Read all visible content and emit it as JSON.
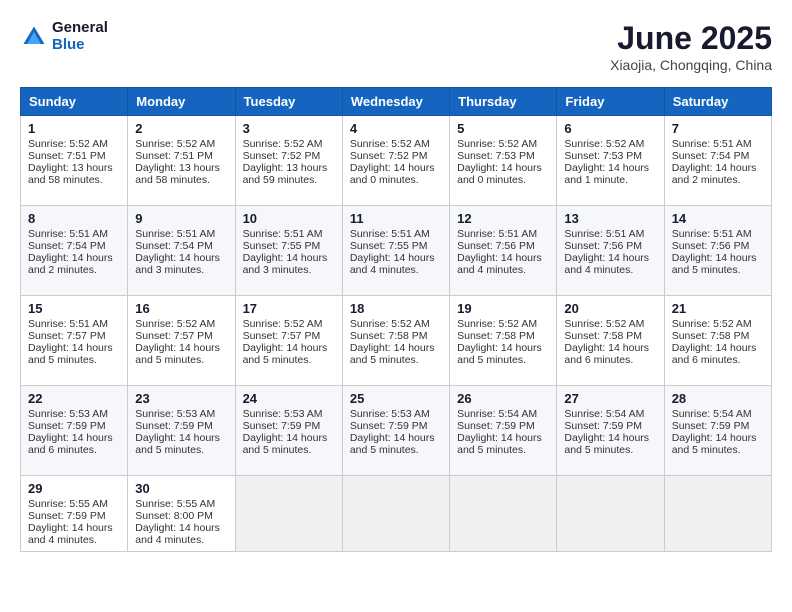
{
  "header": {
    "logo_general": "General",
    "logo_blue": "Blue",
    "month_title": "June 2025",
    "subtitle": "Xiaojia, Chongqing, China"
  },
  "weekdays": [
    "Sunday",
    "Monday",
    "Tuesday",
    "Wednesday",
    "Thursday",
    "Friday",
    "Saturday"
  ],
  "weeks": [
    [
      {
        "day": "1",
        "lines": [
          "Sunrise: 5:52 AM",
          "Sunset: 7:51 PM",
          "Daylight: 13 hours",
          "and 58 minutes."
        ]
      },
      {
        "day": "2",
        "lines": [
          "Sunrise: 5:52 AM",
          "Sunset: 7:51 PM",
          "Daylight: 13 hours",
          "and 58 minutes."
        ]
      },
      {
        "day": "3",
        "lines": [
          "Sunrise: 5:52 AM",
          "Sunset: 7:52 PM",
          "Daylight: 13 hours",
          "and 59 minutes."
        ]
      },
      {
        "day": "4",
        "lines": [
          "Sunrise: 5:52 AM",
          "Sunset: 7:52 PM",
          "Daylight: 14 hours",
          "and 0 minutes."
        ]
      },
      {
        "day": "5",
        "lines": [
          "Sunrise: 5:52 AM",
          "Sunset: 7:53 PM",
          "Daylight: 14 hours",
          "and 0 minutes."
        ]
      },
      {
        "day": "6",
        "lines": [
          "Sunrise: 5:52 AM",
          "Sunset: 7:53 PM",
          "Daylight: 14 hours",
          "and 1 minute."
        ]
      },
      {
        "day": "7",
        "lines": [
          "Sunrise: 5:51 AM",
          "Sunset: 7:54 PM",
          "Daylight: 14 hours",
          "and 2 minutes."
        ]
      }
    ],
    [
      {
        "day": "8",
        "lines": [
          "Sunrise: 5:51 AM",
          "Sunset: 7:54 PM",
          "Daylight: 14 hours",
          "and 2 minutes."
        ]
      },
      {
        "day": "9",
        "lines": [
          "Sunrise: 5:51 AM",
          "Sunset: 7:54 PM",
          "Daylight: 14 hours",
          "and 3 minutes."
        ]
      },
      {
        "day": "10",
        "lines": [
          "Sunrise: 5:51 AM",
          "Sunset: 7:55 PM",
          "Daylight: 14 hours",
          "and 3 minutes."
        ]
      },
      {
        "day": "11",
        "lines": [
          "Sunrise: 5:51 AM",
          "Sunset: 7:55 PM",
          "Daylight: 14 hours",
          "and 4 minutes."
        ]
      },
      {
        "day": "12",
        "lines": [
          "Sunrise: 5:51 AM",
          "Sunset: 7:56 PM",
          "Daylight: 14 hours",
          "and 4 minutes."
        ]
      },
      {
        "day": "13",
        "lines": [
          "Sunrise: 5:51 AM",
          "Sunset: 7:56 PM",
          "Daylight: 14 hours",
          "and 4 minutes."
        ]
      },
      {
        "day": "14",
        "lines": [
          "Sunrise: 5:51 AM",
          "Sunset: 7:56 PM",
          "Daylight: 14 hours",
          "and 5 minutes."
        ]
      }
    ],
    [
      {
        "day": "15",
        "lines": [
          "Sunrise: 5:51 AM",
          "Sunset: 7:57 PM",
          "Daylight: 14 hours",
          "and 5 minutes."
        ]
      },
      {
        "day": "16",
        "lines": [
          "Sunrise: 5:52 AM",
          "Sunset: 7:57 PM",
          "Daylight: 14 hours",
          "and 5 minutes."
        ]
      },
      {
        "day": "17",
        "lines": [
          "Sunrise: 5:52 AM",
          "Sunset: 7:57 PM",
          "Daylight: 14 hours",
          "and 5 minutes."
        ]
      },
      {
        "day": "18",
        "lines": [
          "Sunrise: 5:52 AM",
          "Sunset: 7:58 PM",
          "Daylight: 14 hours",
          "and 5 minutes."
        ]
      },
      {
        "day": "19",
        "lines": [
          "Sunrise: 5:52 AM",
          "Sunset: 7:58 PM",
          "Daylight: 14 hours",
          "and 5 minutes."
        ]
      },
      {
        "day": "20",
        "lines": [
          "Sunrise: 5:52 AM",
          "Sunset: 7:58 PM",
          "Daylight: 14 hours",
          "and 6 minutes."
        ]
      },
      {
        "day": "21",
        "lines": [
          "Sunrise: 5:52 AM",
          "Sunset: 7:58 PM",
          "Daylight: 14 hours",
          "and 6 minutes."
        ]
      }
    ],
    [
      {
        "day": "22",
        "lines": [
          "Sunrise: 5:53 AM",
          "Sunset: 7:59 PM",
          "Daylight: 14 hours",
          "and 6 minutes."
        ]
      },
      {
        "day": "23",
        "lines": [
          "Sunrise: 5:53 AM",
          "Sunset: 7:59 PM",
          "Daylight: 14 hours",
          "and 5 minutes."
        ]
      },
      {
        "day": "24",
        "lines": [
          "Sunrise: 5:53 AM",
          "Sunset: 7:59 PM",
          "Daylight: 14 hours",
          "and 5 minutes."
        ]
      },
      {
        "day": "25",
        "lines": [
          "Sunrise: 5:53 AM",
          "Sunset: 7:59 PM",
          "Daylight: 14 hours",
          "and 5 minutes."
        ]
      },
      {
        "day": "26",
        "lines": [
          "Sunrise: 5:54 AM",
          "Sunset: 7:59 PM",
          "Daylight: 14 hours",
          "and 5 minutes."
        ]
      },
      {
        "day": "27",
        "lines": [
          "Sunrise: 5:54 AM",
          "Sunset: 7:59 PM",
          "Daylight: 14 hours",
          "and 5 minutes."
        ]
      },
      {
        "day": "28",
        "lines": [
          "Sunrise: 5:54 AM",
          "Sunset: 7:59 PM",
          "Daylight: 14 hours",
          "and 5 minutes."
        ]
      }
    ],
    [
      {
        "day": "29",
        "lines": [
          "Sunrise: 5:55 AM",
          "Sunset: 7:59 PM",
          "Daylight: 14 hours",
          "and 4 minutes."
        ]
      },
      {
        "day": "30",
        "lines": [
          "Sunrise: 5:55 AM",
          "Sunset: 8:00 PM",
          "Daylight: 14 hours",
          "and 4 minutes."
        ]
      },
      {
        "day": "",
        "lines": []
      },
      {
        "day": "",
        "lines": []
      },
      {
        "day": "",
        "lines": []
      },
      {
        "day": "",
        "lines": []
      },
      {
        "day": "",
        "lines": []
      }
    ]
  ]
}
